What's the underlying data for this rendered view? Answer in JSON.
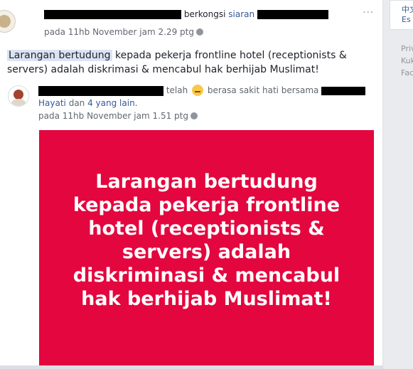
{
  "post": {
    "verb": "berkongsi",
    "shared_word": "siaran",
    "time": "pada 11hb November jam 2.29 ptg",
    "more": "···",
    "text_highlight": "Larangan bertudung",
    "text_rest_line1": " kepada pekerja frontline hotel (receptionists &",
    "text_line2": "servers) adalah diskrimasi & mencabul hak berhijab Muslimat!"
  },
  "shared": {
    "feeling_prefix": "telah",
    "feeling_text": "berasa sakit hati bersama",
    "tagged_first": "Hayati",
    "tagged_and": "dan",
    "tagged_others": "4 yang lain.",
    "time": "pada 11hb November jam 1.51 ptg"
  },
  "poster": {
    "lines": [
      "Larangan bertudung",
      "kepada pekerja frontline",
      "hotel (receptionists &",
      "servers) adalah",
      "diskriminasi & mencabul",
      "hak berhijab Muslimat!"
    ],
    "bg_color": "#e4063e"
  },
  "sidebar": {
    "lang_line1": "中文",
    "lang_line2": "Es",
    "footer": [
      "Priv",
      "Kuk",
      "Fac"
    ]
  }
}
